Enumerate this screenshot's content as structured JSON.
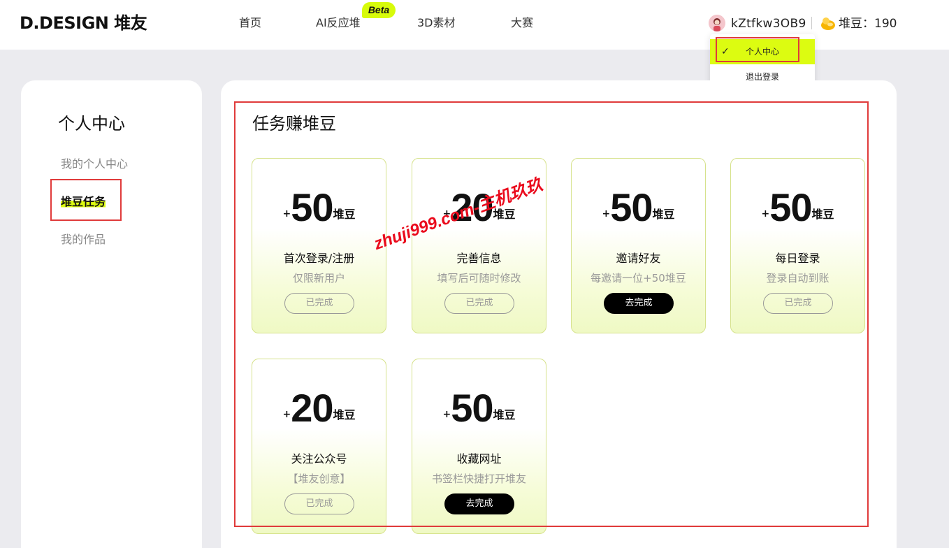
{
  "header": {
    "logo": "D.DESIGN 堆友",
    "nav": [
      "首页",
      "AI反应堆",
      "3D素材",
      "大赛"
    ],
    "beta_badge": "Beta",
    "username": "kZtfkw3OB9",
    "beans_label": "堆豆：190"
  },
  "dropdown": {
    "items": [
      "个人中心",
      "退出登录"
    ],
    "selected": "个人中心"
  },
  "sidebar": {
    "title": "个人中心",
    "items": [
      "我的个人中心",
      "堆豆任务",
      "我的作品"
    ],
    "active": "堆豆任务"
  },
  "main": {
    "title": "任务赚堆豆",
    "plus": "+",
    "unit": "堆豆",
    "tasks": [
      {
        "points": "50",
        "title": "首次登录/注册",
        "subtitle": "仅限新用户",
        "button": "已完成",
        "status": "done"
      },
      {
        "points": "20",
        "title": "完善信息",
        "subtitle": "填写后可随时修改",
        "button": "已完成",
        "status": "done"
      },
      {
        "points": "50",
        "title": "邀请好友",
        "subtitle": "每邀请一位+50堆豆",
        "button": "去完成",
        "status": "todo"
      },
      {
        "points": "50",
        "title": "每日登录",
        "subtitle": "登录自动到账",
        "button": "已完成",
        "status": "done"
      },
      {
        "points": "20",
        "title": "关注公众号",
        "subtitle": "【堆友创意】",
        "button": "已完成",
        "status": "done"
      },
      {
        "points": "50",
        "title": "收藏网址",
        "subtitle": "书签栏快捷打开堆友",
        "button": "去完成",
        "status": "todo"
      }
    ]
  },
  "watermark": "zhuji999.com-主机玖玖",
  "colors": {
    "accent": "#dcfc11",
    "highlight_box": "#e03b3b",
    "watermark": "#ea0a1c"
  }
}
